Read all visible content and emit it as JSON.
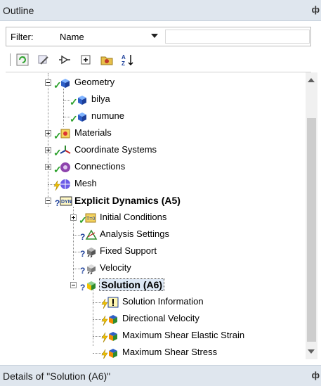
{
  "panels": {
    "outline_title": "Outline",
    "details_title": "Details of \"Solution (A6)\"",
    "pin_glyph": "ф"
  },
  "filter": {
    "label": "Filter:",
    "selected": "Name",
    "text_value": ""
  },
  "toolbar": {
    "buttons": [
      "refresh-icon",
      "wizard-icon",
      "connector-icon",
      "expand-all-icon",
      "folder-icon",
      "sort-az-icon"
    ]
  },
  "tree": {
    "geometry": "Geometry",
    "bilya": "bilya",
    "numune": "numune",
    "materials": "Materials",
    "coordinate_systems": "Coordinate Systems",
    "connections": "Connections",
    "mesh": "Mesh",
    "explicit_dynamics": "Explicit Dynamics (A5)",
    "initial_conditions": "Initial Conditions",
    "analysis_settings": "Analysis Settings",
    "fixed_support": "Fixed Support",
    "velocity": "Velocity",
    "solution": "Solution (A6)",
    "solution_information": "Solution Information",
    "directional_velocity": "Directional Velocity",
    "max_shear_elastic_strain": "Maximum Shear Elastic Strain",
    "max_shear_stress": "Maximum Shear Stress"
  },
  "colors": {
    "header_bg": "#dfe6ee",
    "check_green": "#2aa02a",
    "question_blue": "#1c3f9a",
    "bolt_yellow": "#f2c200"
  }
}
